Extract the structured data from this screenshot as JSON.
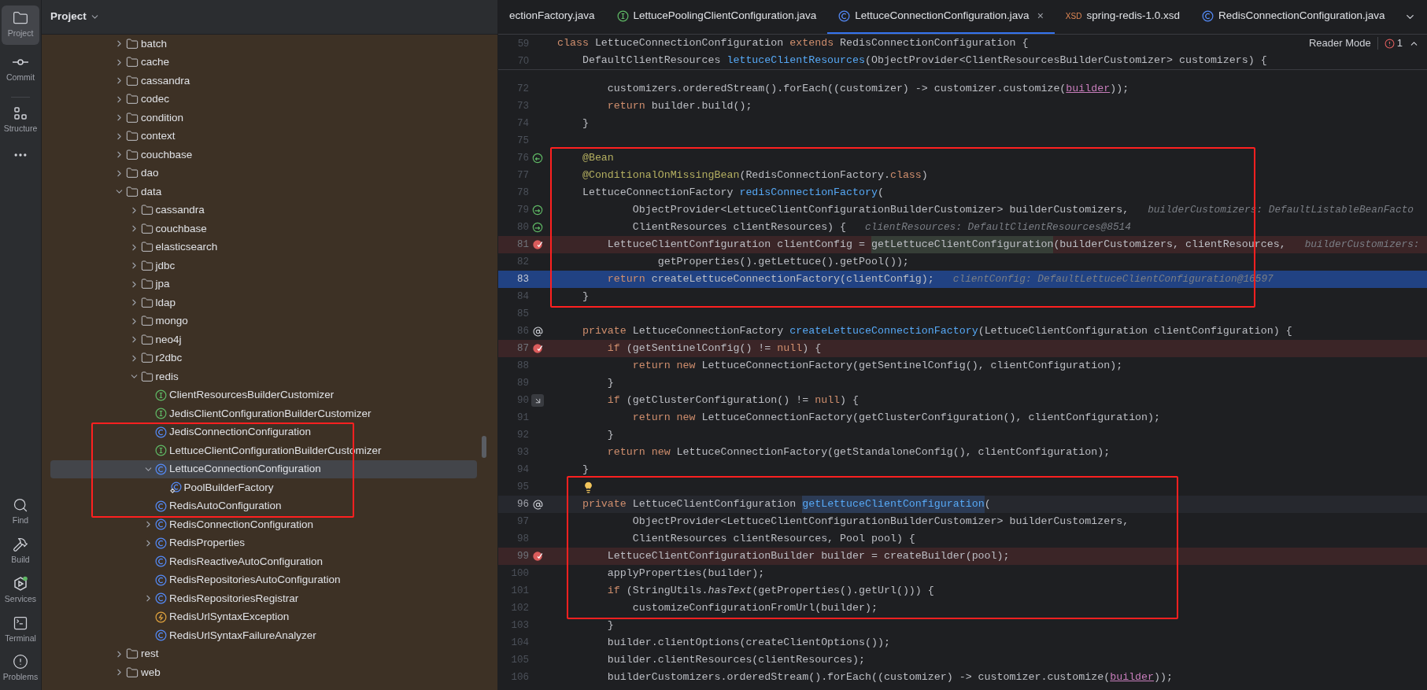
{
  "tool_strip": {
    "top": [
      {
        "kind": "project",
        "label": "Project",
        "selected": true
      },
      {
        "kind": "commit",
        "label": "Commit",
        "selected": false
      },
      {
        "kind": "structure",
        "label": "Structure",
        "selected": false
      },
      {
        "kind": "more",
        "selected": false
      }
    ],
    "bottom": [
      {
        "kind": "find",
        "label": "Find"
      },
      {
        "kind": "build",
        "label": "Build"
      },
      {
        "kind": "services",
        "label": "Services"
      },
      {
        "kind": "terminal",
        "label": "Terminal"
      },
      {
        "kind": "problems",
        "label": "Problems"
      }
    ]
  },
  "project_panel": {
    "title": "Project",
    "tree": [
      {
        "kind": "folder",
        "label": "batch",
        "expanded": false,
        "selected": false,
        "boxed": false
      },
      {
        "kind": "folder",
        "label": "cache",
        "expanded": false,
        "selected": false,
        "boxed": false
      },
      {
        "kind": "folder",
        "label": "cassandra",
        "expanded": false,
        "selected": false,
        "boxed": false
      },
      {
        "kind": "folder",
        "label": "codec",
        "expanded": false,
        "selected": false,
        "boxed": false
      },
      {
        "kind": "folder",
        "label": "condition",
        "expanded": false,
        "selected": false,
        "boxed": false
      },
      {
        "kind": "folder",
        "label": "context",
        "expanded": false,
        "selected": false,
        "boxed": false
      },
      {
        "kind": "folder",
        "label": "couchbase",
        "expanded": false,
        "selected": false,
        "boxed": false
      },
      {
        "kind": "folder",
        "label": "dao",
        "expanded": false,
        "selected": false,
        "boxed": false
      },
      {
        "kind": "folder",
        "label": "data",
        "expanded": true,
        "selected": false,
        "boxed": false,
        "children": [
          {
            "kind": "folder",
            "label": "cassandra",
            "expanded": false,
            "selected": false,
            "boxed": false
          },
          {
            "kind": "folder",
            "label": "couchbase",
            "expanded": false,
            "selected": false,
            "boxed": false
          },
          {
            "kind": "folder",
            "label": "elasticsearch",
            "expanded": false,
            "selected": false,
            "boxed": false
          },
          {
            "kind": "folder",
            "label": "jdbc",
            "expanded": false,
            "selected": false,
            "boxed": false
          },
          {
            "kind": "folder",
            "label": "jpa",
            "expanded": false,
            "selected": false,
            "boxed": false
          },
          {
            "kind": "folder",
            "label": "ldap",
            "expanded": false,
            "selected": false,
            "boxed": false
          },
          {
            "kind": "folder",
            "label": "mongo",
            "expanded": false,
            "selected": false,
            "boxed": false
          },
          {
            "kind": "folder",
            "label": "neo4j",
            "expanded": false,
            "selected": false,
            "boxed": false
          },
          {
            "kind": "folder",
            "label": "r2dbc",
            "expanded": false,
            "selected": false,
            "boxed": false
          },
          {
            "kind": "folder",
            "label": "redis",
            "expanded": true,
            "selected": false,
            "boxed": false,
            "children": [
              {
                "kind": "interface",
                "label": "ClientResourcesBuilderCustomizer",
                "selected": false,
                "boxed": false
              },
              {
                "kind": "interface",
                "label": "JedisClientConfigurationBuilderCustomizer",
                "selected": false,
                "boxed": false
              },
              {
                "kind": "class",
                "label": "JedisConnectionConfiguration",
                "selected": false,
                "boxed": true
              },
              {
                "kind": "interface",
                "label": "LettuceClientConfigurationBuilderCustomizer",
                "selected": false,
                "boxed": true
              },
              {
                "kind": "class",
                "label": "LettuceConnectionConfiguration",
                "expanded": true,
                "selected": true,
                "boxed": true,
                "children": [
                  {
                    "kind": "nested-class",
                    "label": "PoolBuilderFactory",
                    "selected": false,
                    "boxed": true
                  }
                ]
              },
              {
                "kind": "class",
                "label": "RedisAutoConfiguration",
                "selected": false,
                "boxed": true
              },
              {
                "kind": "class",
                "label": "RedisConnectionConfiguration",
                "expanded": false,
                "selected": false,
                "boxed": false
              },
              {
                "kind": "class",
                "label": "RedisProperties",
                "expanded": false,
                "selected": false,
                "boxed": false
              },
              {
                "kind": "class",
                "label": "RedisReactiveAutoConfiguration",
                "selected": false,
                "boxed": false
              },
              {
                "kind": "class",
                "label": "RedisRepositoriesAutoConfiguration",
                "selected": false,
                "boxed": false
              },
              {
                "kind": "class",
                "label": "RedisRepositoriesRegistrar",
                "expanded": false,
                "selected": false,
                "boxed": false
              },
              {
                "kind": "exception",
                "label": "RedisUrlSyntaxException",
                "selected": false,
                "boxed": false
              },
              {
                "kind": "class",
                "label": "RedisUrlSyntaxFailureAnalyzer",
                "selected": false,
                "boxed": false
              }
            ]
          }
        ]
      },
      {
        "kind": "folder",
        "label": "rest",
        "expanded": false,
        "selected": false,
        "boxed": false
      },
      {
        "kind": "folder",
        "label": "web",
        "expanded": false,
        "selected": false,
        "boxed": false
      }
    ]
  },
  "editor": {
    "tabs": [
      {
        "kind": "none",
        "label": "ectionFactory.java",
        "selected": false
      },
      {
        "kind": "interface",
        "label": "LettucePoolingClientConfiguration.java",
        "selected": false
      },
      {
        "kind": "class",
        "label": "LettuceConnectionConfiguration.java",
        "selected": true,
        "close": "×"
      },
      {
        "kind": "xsd",
        "badge": "XSD",
        "label": "spring-redis-1.0.xsd",
        "selected": false
      },
      {
        "kind": "class",
        "label": "RedisConnectionConfiguration.java",
        "selected": false
      }
    ],
    "reader_mode": "Reader Mode",
    "problems_count": "1",
    "sticky_lines": [
      {
        "number": "59",
        "segments": [
          {
            "text": "class ",
            "kind": "kw"
          },
          {
            "text": "LettuceConnectionConfiguration ",
            "kind": "plain"
          },
          {
            "text": "extends ",
            "kind": "kw"
          },
          {
            "text": "RedisConnectionConfiguration {",
            "kind": "plain"
          }
        ]
      },
      {
        "number": "70",
        "segments": [
          {
            "text": "    DefaultClientResources ",
            "kind": "plain"
          },
          {
            "text": "lettuceClientResources",
            "kind": "method"
          },
          {
            "text": "(ObjectProvider<ClientResourcesBuilderCustomizer> customizers) {",
            "kind": "plain"
          }
        ]
      }
    ],
    "lines": [
      {
        "number": "72",
        "kind": "plain",
        "boxed": false,
        "segments": [
          {
            "text": "        customizers.orderedStream().forEach((customizer) -> customizer.customize(",
            "kind": "plain"
          },
          {
            "text": "builder",
            "kind": "ref"
          },
          {
            "text": "));",
            "kind": "plain"
          }
        ]
      },
      {
        "number": "73",
        "kind": "plain",
        "boxed": false,
        "segments": [
          {
            "text": "        return ",
            "kind": "kw"
          },
          {
            "text": "builder.build();",
            "kind": "plain"
          }
        ]
      },
      {
        "number": "74",
        "kind": "plain",
        "boxed": false,
        "segments": [
          {
            "text": "    }",
            "kind": "plain"
          }
        ]
      },
      {
        "number": "75",
        "kind": "plain",
        "boxed": false
      },
      {
        "number": "76",
        "kind": "plain",
        "boxed": true,
        "gutter": {
          "kind": "bean"
        },
        "segments": [
          {
            "text": "    @Bean",
            "kind": "annotation"
          }
        ]
      },
      {
        "number": "77",
        "kind": "plain",
        "boxed": true,
        "segments": [
          {
            "text": "    @ConditionalOnMissingBean",
            "kind": "annotation"
          },
          {
            "text": "(RedisConnectionFactory.",
            "kind": "plain"
          },
          {
            "text": "class",
            "kind": "kw"
          },
          {
            "text": ")",
            "kind": "plain"
          }
        ]
      },
      {
        "number": "78",
        "kind": "plain",
        "boxed": true,
        "segments": [
          {
            "text": "    LettuceConnectionFactory ",
            "kind": "plain"
          },
          {
            "text": "redisConnectionFactory",
            "kind": "method"
          },
          {
            "text": "(",
            "kind": "plain"
          }
        ]
      },
      {
        "number": "79",
        "kind": "plain",
        "boxed": true,
        "gutter": {
          "kind": "inject"
        },
        "segments": [
          {
            "text": "            ObjectProvider<LettuceClientConfigurationBuilderCustomizer> builderCustomizers,",
            "kind": "plain"
          },
          {
            "text": "builderCustomizers: DefaultListableBeanFacto",
            "kind": "hint"
          }
        ]
      },
      {
        "number": "80",
        "kind": "plain",
        "boxed": true,
        "gutter": {
          "kind": "inject"
        },
        "segments": [
          {
            "text": "            ClientResources clientResources) {",
            "kind": "plain"
          },
          {
            "text": "clientResources: DefaultClientResources@8514",
            "kind": "hint"
          }
        ]
      },
      {
        "number": "81",
        "kind": "breakpoint",
        "boxed": true,
        "gutter": {
          "kind": "breakpoint"
        },
        "segments": [
          {
            "text": "        LettuceClientConfiguration clientConfig = ",
            "kind": "plain"
          },
          {
            "text": "getLettuceClientConfiguration",
            "kind": "usage"
          },
          {
            "text": "(builderCustomizers, clientResources,",
            "kind": "plain"
          },
          {
            "text": "builderCustomizers:",
            "kind": "hint"
          }
        ]
      },
      {
        "number": "82",
        "kind": "plain",
        "boxed": true,
        "segments": [
          {
            "text": "                getProperties().getLettuce().getPool());",
            "kind": "plain"
          }
        ]
      },
      {
        "number": "83",
        "kind": "execution",
        "boxed": true,
        "segments": [
          {
            "text": "        return ",
            "kind": "kw"
          },
          {
            "text": "createLettuceConnectionFactory(clientConfig);",
            "kind": "plain"
          },
          {
            "text": "clientConfig: DefaultLettuceClientConfiguration@16597",
            "kind": "hint"
          }
        ]
      },
      {
        "number": "84",
        "kind": "plain",
        "boxed": true,
        "segments": [
          {
            "text": "    }",
            "kind": "plain"
          }
        ]
      },
      {
        "number": "85",
        "kind": "plain",
        "boxed": false
      },
      {
        "number": "86",
        "kind": "plain",
        "boxed": false,
        "gutter": {
          "kind": "at"
        },
        "segments": [
          {
            "text": "    private ",
            "kind": "kw"
          },
          {
            "text": "LettuceConnectionFactory ",
            "kind": "plain"
          },
          {
            "text": "createLettuceConnectionFactory",
            "kind": "method"
          },
          {
            "text": "(LettuceClientConfiguration clientConfiguration) {",
            "kind": "plain"
          }
        ]
      },
      {
        "number": "87",
        "kind": "breakpoint",
        "boxed": false,
        "gutter": {
          "kind": "breakpoint"
        },
        "segments": [
          {
            "text": "        if ",
            "kind": "kw"
          },
          {
            "text": "(getSentinelConfig() != ",
            "kind": "plain"
          },
          {
            "text": "null",
            "kind": "kw"
          },
          {
            "text": ") {",
            "kind": "plain"
          }
        ]
      },
      {
        "number": "88",
        "kind": "plain",
        "boxed": false,
        "segments": [
          {
            "text": "            return new ",
            "kind": "kw"
          },
          {
            "text": "LettuceConnectionFactory(getSentinelConfig(), clientConfiguration);",
            "kind": "plain"
          }
        ]
      },
      {
        "number": "89",
        "kind": "plain",
        "boxed": false,
        "segments": [
          {
            "text": "        }",
            "kind": "plain"
          }
        ]
      },
      {
        "number": "90",
        "kind": "plain",
        "boxed": false,
        "gutter": {
          "kind": "step"
        },
        "segments": [
          {
            "text": "        if ",
            "kind": "kw"
          },
          {
            "text": "(getClusterConfiguration() != ",
            "kind": "plain"
          },
          {
            "text": "null",
            "kind": "kw"
          },
          {
            "text": ") {",
            "kind": "plain"
          }
        ]
      },
      {
        "number": "91",
        "kind": "plain",
        "boxed": false,
        "segments": [
          {
            "text": "            return new ",
            "kind": "kw"
          },
          {
            "text": "LettuceConnectionFactory(getClusterConfiguration(), clientConfiguration);",
            "kind": "plain"
          }
        ]
      },
      {
        "number": "92",
        "kind": "plain",
        "boxed": false,
        "segments": [
          {
            "text": "        }",
            "kind": "plain"
          }
        ]
      },
      {
        "number": "93",
        "kind": "plain",
        "boxed": false,
        "segments": [
          {
            "text": "        return new ",
            "kind": "kw"
          },
          {
            "text": "LettuceConnectionFactory(getStandaloneConfig(), clientConfiguration);",
            "kind": "plain"
          }
        ]
      },
      {
        "number": "94",
        "kind": "plain",
        "boxed": false,
        "segments": [
          {
            "text": "    }",
            "kind": "plain"
          }
        ]
      },
      {
        "number": "95",
        "kind": "plain",
        "boxed": true,
        "inline": {
          "kind": "bulb"
        }
      },
      {
        "number": "96",
        "kind": "caret",
        "boxed": true,
        "gutter": {
          "kind": "at"
        },
        "segments": [
          {
            "text": "    private ",
            "kind": "kw"
          },
          {
            "text": "LettuceClientConfiguration ",
            "kind": "plain"
          },
          {
            "text": "getLettuceClientConfiguration",
            "kind": "decl"
          },
          {
            "text": "(",
            "kind": "plain"
          }
        ]
      },
      {
        "number": "97",
        "kind": "plain",
        "boxed": true,
        "segments": [
          {
            "text": "            ObjectProvider<LettuceClientConfigurationBuilderCustomizer> builderCustomizers,",
            "kind": "plain"
          }
        ]
      },
      {
        "number": "98",
        "kind": "plain",
        "boxed": true,
        "segments": [
          {
            "text": "            ClientResources clientResources, Pool pool) {",
            "kind": "plain"
          }
        ]
      },
      {
        "number": "99",
        "kind": "breakpoint",
        "boxed": true,
        "gutter": {
          "kind": "breakpoint"
        },
        "segments": [
          {
            "text": "        LettuceClientConfigurationBuilder builder = createBuilder(pool);",
            "kind": "plain"
          }
        ]
      },
      {
        "number": "100",
        "kind": "plain",
        "boxed": true,
        "segments": [
          {
            "text": "        applyProperties(builder);",
            "kind": "plain"
          }
        ]
      },
      {
        "number": "101",
        "kind": "plain",
        "boxed": true,
        "segments": [
          {
            "text": "        if ",
            "kind": "kw"
          },
          {
            "text": "(StringUtils.",
            "kind": "plain"
          },
          {
            "text": "hasText",
            "kind": "italic"
          },
          {
            "text": "(getProperties().getUrl())) {",
            "kind": "plain"
          }
        ]
      },
      {
        "number": "102",
        "kind": "plain",
        "boxed": true,
        "segments": [
          {
            "text": "            customizeConfigurationFromUrl(builder);",
            "kind": "plain"
          }
        ]
      },
      {
        "number": "103",
        "kind": "plain",
        "boxed": false,
        "segments": [
          {
            "text": "        }",
            "kind": "plain"
          }
        ]
      },
      {
        "number": "104",
        "kind": "plain",
        "boxed": false,
        "segments": [
          {
            "text": "        builder.clientOptions(createClientOptions());",
            "kind": "plain"
          }
        ]
      },
      {
        "number": "105",
        "kind": "plain",
        "boxed": false,
        "segments": [
          {
            "text": "        builder.clientResources(clientResources);",
            "kind": "plain"
          }
        ]
      },
      {
        "number": "106",
        "kind": "plain",
        "boxed": false,
        "segments": [
          {
            "text": "        builderCustomizers.orderedStream().forEach((customizer) -> customizer.customize(",
            "kind": "plain"
          },
          {
            "text": "builder",
            "kind": "ref"
          },
          {
            "text": "));",
            "kind": "plain"
          }
        ]
      }
    ]
  }
}
